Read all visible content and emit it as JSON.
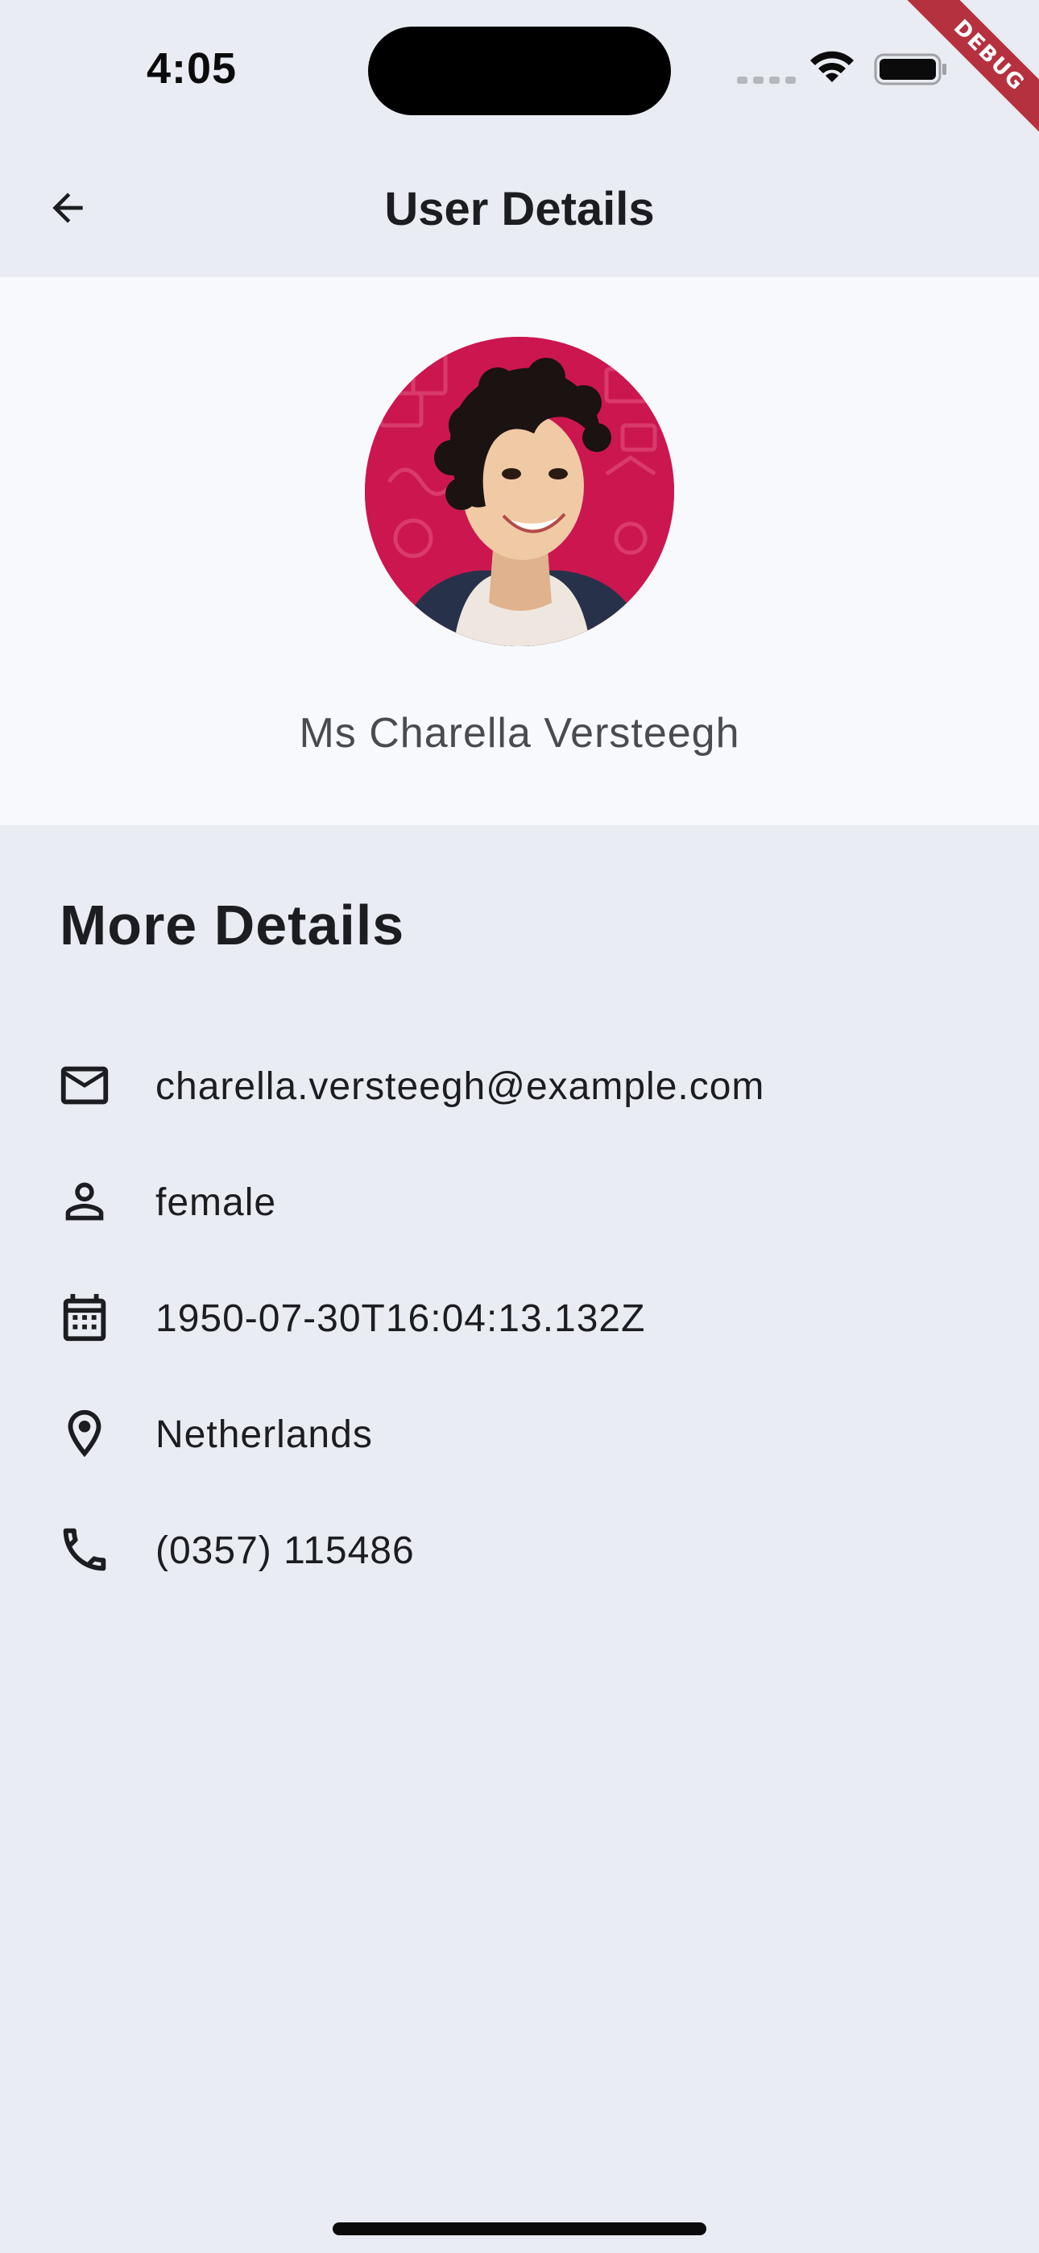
{
  "status_bar": {
    "time": "4:05",
    "icons": [
      "signal-dots",
      "wifi-icon",
      "battery-icon"
    ]
  },
  "debug_banner": {
    "label": "DEBUG",
    "color": "#b5313f"
  },
  "app_bar": {
    "back_icon": "arrow-back-icon",
    "title": "User Details"
  },
  "profile": {
    "avatar_icon": "avatar-photo",
    "name": "Ms Charella Versteegh"
  },
  "more_details": {
    "title": "More Details",
    "items": [
      {
        "icon": "mail-icon",
        "text": "charella.versteegh@example.com"
      },
      {
        "icon": "person-icon",
        "text": "female"
      },
      {
        "icon": "calendar-icon",
        "text": "1950-07-30T16:04:13.132Z"
      },
      {
        "icon": "location-pin-icon",
        "text": "Netherlands"
      },
      {
        "icon": "phone-icon",
        "text": "(0357) 115486"
      }
    ]
  },
  "colors": {
    "background": "#e9ecf2",
    "card": "#f7f9fc",
    "text": "#1c1d20",
    "muted_text": "#4a4b50"
  }
}
